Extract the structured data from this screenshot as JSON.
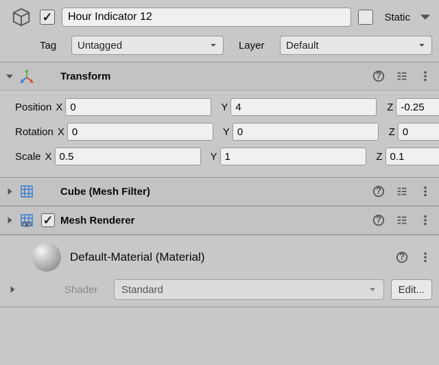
{
  "header": {
    "object_name": "Hour Indicator 12",
    "active": true,
    "static_label": "Static",
    "static_checked": false,
    "tag_label": "Tag",
    "tag_value": "Untagged",
    "layer_label": "Layer",
    "layer_value": "Default"
  },
  "components": {
    "transform": {
      "title": "Transform",
      "expanded": true,
      "rows": {
        "position": {
          "label": "Position",
          "x": "0",
          "y": "4",
          "z": "-0.25"
        },
        "rotation": {
          "label": "Rotation",
          "x": "0",
          "y": "0",
          "z": "0"
        },
        "scale": {
          "label": "Scale",
          "x": "0.5",
          "y": "1",
          "z": "0.1"
        }
      }
    },
    "mesh_filter": {
      "title": "Cube (Mesh Filter)",
      "expanded": false
    },
    "mesh_renderer": {
      "title": "Mesh Renderer",
      "enabled": true,
      "expanded": false
    }
  },
  "material": {
    "name": "Default-Material (Material)",
    "shader_label": "Shader",
    "shader_value": "Standard",
    "edit_label": "Edit..."
  },
  "axes": {
    "x": "X",
    "y": "Y",
    "z": "Z"
  }
}
